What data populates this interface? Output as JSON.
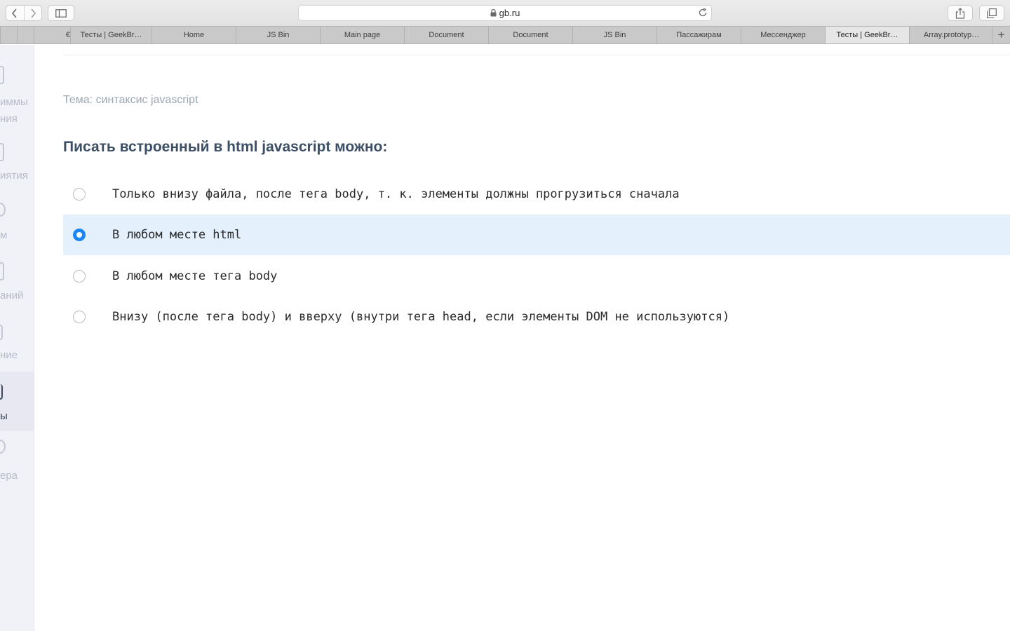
{
  "browser": {
    "url": "gb.ru",
    "tabs": [
      {
        "label": "Тесты | GeekBr…",
        "active": false
      },
      {
        "label": "Home",
        "active": false
      },
      {
        "label": "JS Bin",
        "active": false
      },
      {
        "label": "Main page",
        "active": false
      },
      {
        "label": "Document",
        "active": false
      },
      {
        "label": "Document",
        "active": false
      },
      {
        "label": "JS Bin",
        "active": false
      },
      {
        "label": "Пассажирам",
        "active": false
      },
      {
        "label": "Мессенджер",
        "active": false
      },
      {
        "label": "Тесты | GeekBr…",
        "active": true
      },
      {
        "label": "Array.prototyp…",
        "active": false
      }
    ],
    "partial_tab_label": "€",
    "new_tab_symbol": "+"
  },
  "sidebar": {
    "items": [
      {
        "label": "иммы\nния",
        "icon": "program-icon",
        "active": false
      },
      {
        "label": "иятия",
        "icon": "lesson-icon",
        "active": false
      },
      {
        "label": "м",
        "icon": "chat-icon",
        "active": false
      },
      {
        "label": "аний",
        "icon": "task-icon",
        "active": false
      },
      {
        "label": "ние",
        "icon": "info-icon",
        "active": false
      },
      {
        "label": "ы",
        "icon": "test-icon",
        "active": true
      },
      {
        "label": "ера",
        "icon": "career-icon",
        "active": false
      }
    ]
  },
  "quiz": {
    "topic": "Тема: синтаксис javascript",
    "question": "Писать встроенный в html javascript можно:",
    "answers": [
      {
        "text": "Только внизу файла, после тега body, т. к. элементы должны прогрузиться сначала",
        "selected": false
      },
      {
        "text": "В любом месте html",
        "selected": true
      },
      {
        "text": "В любом месте тега body",
        "selected": false
      },
      {
        "text": "Внизу (после тега body) и вверху (внутри тега head, если элементы DOM не используются)",
        "selected": false
      }
    ]
  },
  "colors": {
    "accent": "#1c86f2",
    "selected_row": "#e4f1fd",
    "question_text": "#3c4f66",
    "topic_text": "#9ea7b3",
    "sidebar_bg": "#f1f1f8"
  }
}
